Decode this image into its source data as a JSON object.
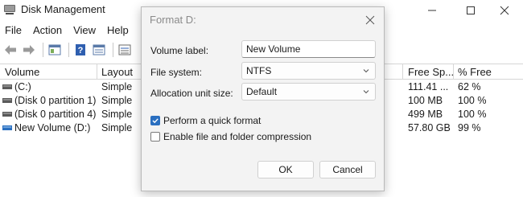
{
  "window": {
    "title": "Disk Management",
    "icon": "disk-management-icon"
  },
  "menu": [
    "File",
    "Action",
    "View",
    "Help"
  ],
  "toolbar": {
    "icons": [
      "back-arrow-icon",
      "forward-arrow-icon",
      "console-tree-icon",
      "help-icon",
      "properties-icon",
      "list-view-icon"
    ]
  },
  "table": {
    "columns": [
      "Volume",
      "Layout",
      "Free Sp...",
      "% Free"
    ],
    "rows": [
      {
        "volume": "(C:)",
        "layout": "Simple",
        "free": "111.41 ...",
        "pct": "62 %"
      },
      {
        "volume": "(Disk 0 partition 1)",
        "layout": "Simple",
        "free": "100 MB",
        "pct": "100 %"
      },
      {
        "volume": "(Disk 0 partition 4)",
        "layout": "Simple",
        "free": "499 MB",
        "pct": "100 %"
      },
      {
        "volume": "New Volume (D:)",
        "layout": "Simple",
        "free": "57.80 GB",
        "pct": "99 %"
      }
    ]
  },
  "dialog": {
    "title": "Format D:",
    "volume_label": {
      "label": "Volume label:",
      "value": "New Volume"
    },
    "file_system": {
      "label": "File system:",
      "value": "NTFS"
    },
    "allocation": {
      "label": "Allocation unit size:",
      "value": "Default"
    },
    "quick_format": {
      "label": "Perform a quick format",
      "checked": true
    },
    "compression": {
      "label": "Enable file and folder compression",
      "checked": false
    },
    "ok_label": "OK",
    "cancel_label": "Cancel"
  },
  "colors": {
    "accent": "#2a6fc0",
    "dialog_bg": "#f3f3f3"
  }
}
